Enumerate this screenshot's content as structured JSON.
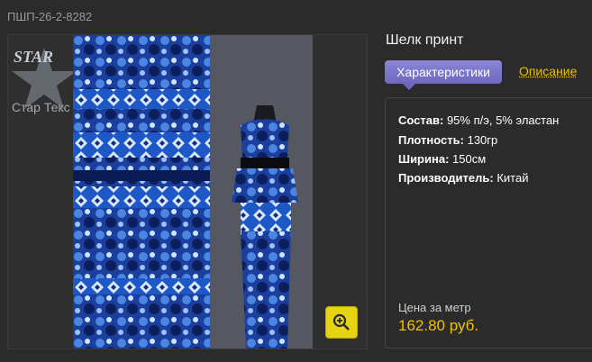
{
  "product": {
    "sku": "ПШП-26-2-8282",
    "title": "Шелк принт"
  },
  "logo": {
    "brand": "STAR",
    "caption": "Стар Текс"
  },
  "tabs": {
    "characteristics": "Характеристики",
    "description": "Описание"
  },
  "specs": [
    {
      "label": "Состав:",
      "value": "95% п/э, 5% эластан"
    },
    {
      "label": "Плотность:",
      "value": "130гр"
    },
    {
      "label": "Ширина:",
      "value": "150см"
    },
    {
      "label": "Производитель:",
      "value": "Китай"
    }
  ],
  "price": {
    "label": "Цена за метр",
    "value": "162.80 руб."
  },
  "colors": {
    "accent": "#e8c400",
    "tab": "#7a74cc",
    "zoom": "#e6d311"
  }
}
